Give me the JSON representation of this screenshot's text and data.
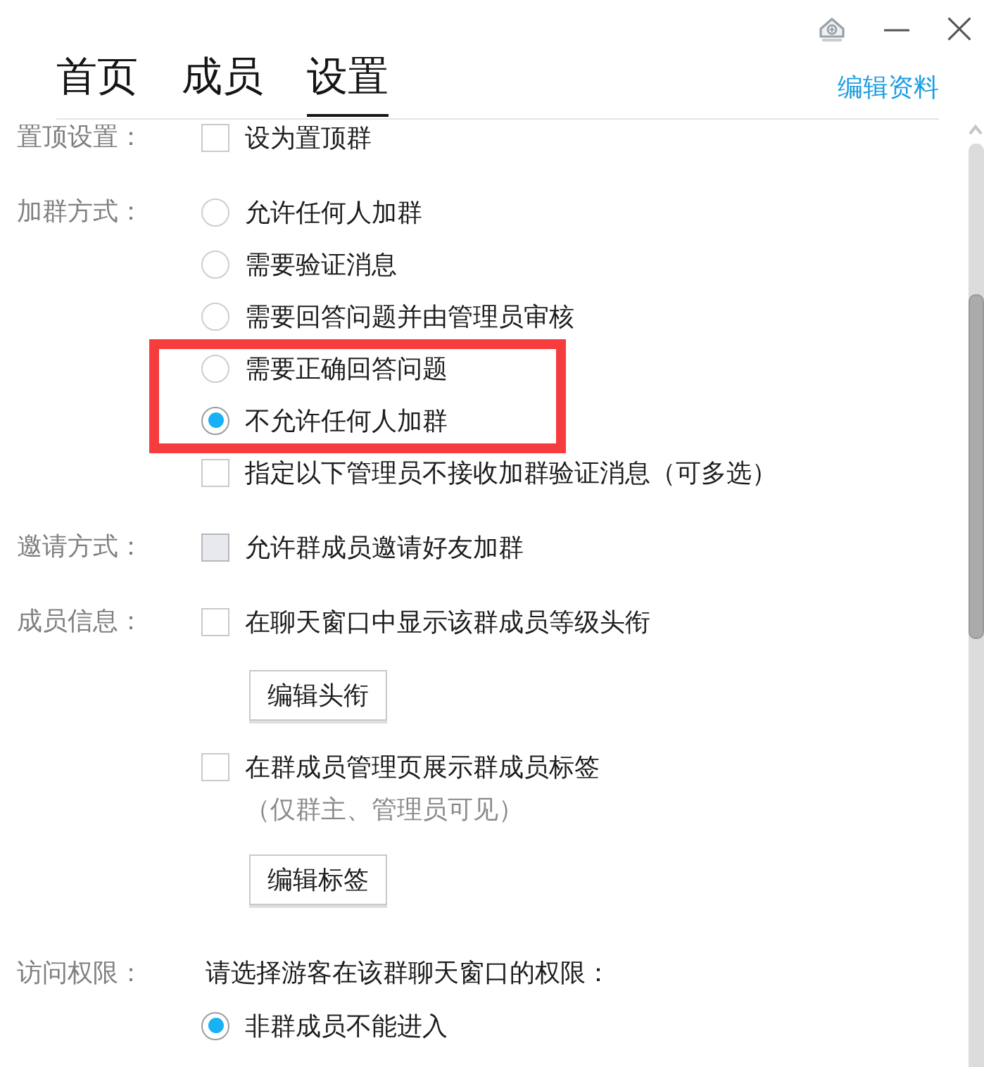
{
  "tabs": [
    {
      "label": "首页",
      "selected": false
    },
    {
      "label": "成员",
      "selected": false
    },
    {
      "label": "设置",
      "selected": true
    }
  ],
  "edit_profile_link": "编辑资料",
  "settings": [
    {
      "label": "置顶设置：",
      "items": [
        {
          "kind": "checkbox",
          "text": "设为置顶群",
          "checked": false,
          "disabled": false
        }
      ]
    },
    {
      "label": "加群方式：",
      "items": [
        {
          "kind": "radio",
          "text": "允许任何人加群",
          "selected": false,
          "disabled": false
        },
        {
          "kind": "radio",
          "text": "需要验证消息",
          "selected": false,
          "disabled": false
        },
        {
          "kind": "radio",
          "text": "需要回答问题并由管理员审核",
          "selected": false,
          "disabled": false
        },
        {
          "kind": "radio",
          "text": "需要正确回答问题",
          "selected": false,
          "disabled": false
        },
        {
          "kind": "radio",
          "text": "不允许任何人加群",
          "selected": true,
          "disabled": false
        },
        {
          "kind": "checkbox",
          "text": "指定以下管理员不接收加群验证消息（可多选）",
          "checked": false,
          "disabled": false
        }
      ]
    },
    {
      "label": "邀请方式：",
      "items": [
        {
          "kind": "checkbox",
          "text": "允许群成员邀请好友加群",
          "checked": false,
          "disabled": true
        }
      ]
    },
    {
      "label": "成员信息：",
      "items": [
        {
          "kind": "checkbox",
          "text": "在聊天窗口中显示该群成员等级头衔",
          "checked": false,
          "disabled": false
        },
        {
          "kind": "button",
          "text": "编辑头衔"
        },
        {
          "kind": "checkbox",
          "text": "在群成员管理页展示群成员标签",
          "checked": false,
          "disabled": false
        },
        {
          "kind": "note",
          "text": "（仅群主、管理员可见）"
        },
        {
          "kind": "button",
          "text": "编辑标签"
        }
      ]
    },
    {
      "label": "访问权限：",
      "items": [
        {
          "kind": "prompt",
          "text": "请选择游客在该群聊天窗口的权限："
        },
        {
          "kind": "radio",
          "text": "非群成员不能进入",
          "selected": true,
          "disabled": false
        }
      ]
    }
  ]
}
